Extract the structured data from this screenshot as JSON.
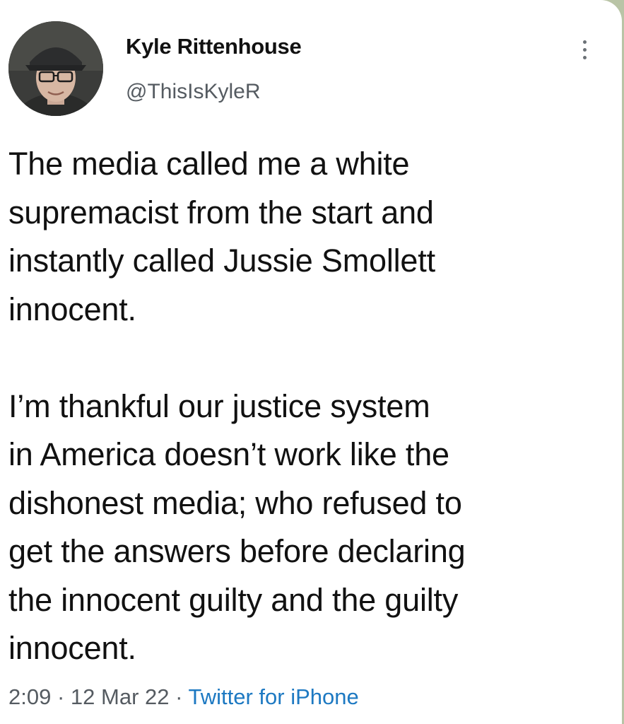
{
  "tweet": {
    "author_name": "Kyle Rittenhouse",
    "author_handle": "@ThisIsKyleR",
    "paragraph_1": "The media called me a white\nsupremacist from the start and\ninstantly called Jussie Smollett\ninnocent.",
    "paragraph_2": "I’m thankful our justice system\nin America doesn’t work like the\ndishonest media; who refused to\nget the answers before declaring\nthe innocent guilty and the guilty\ninnocent.",
    "time": "2:09",
    "separator": "·",
    "date": "12 Mar 22",
    "source": "Twitter for iPhone"
  },
  "icons": {
    "menu": "more-vertical-icon"
  },
  "colors": {
    "link": "#1d79c2",
    "secondary_text": "#555b61",
    "background_outside": "#b9c4a6"
  }
}
